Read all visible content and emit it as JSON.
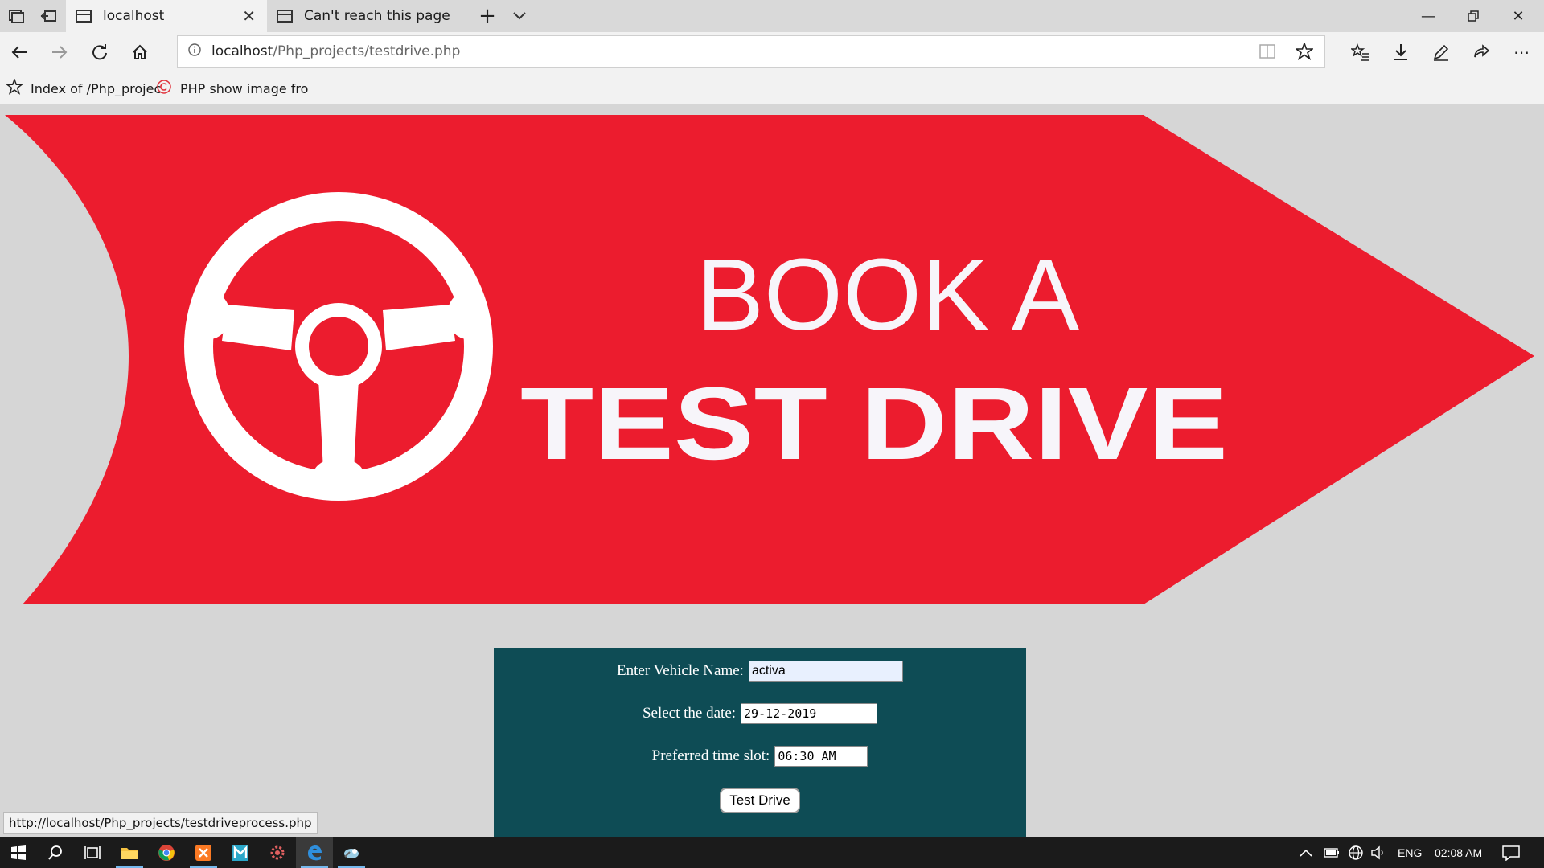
{
  "browser": {
    "tabs": [
      {
        "title": "localhost",
        "active": true
      },
      {
        "title": "Can't reach this page",
        "active": false
      }
    ],
    "address": {
      "host": "localhost",
      "path": "/Php_projects/testdrive.php"
    },
    "favorites": [
      {
        "label": "Index of /Php_projec"
      },
      {
        "label": "PHP show image fro"
      }
    ],
    "status_url": "http://localhost/Php_projects/testdriveprocess.php"
  },
  "banner": {
    "line1": "BOOK A",
    "line2": "TEST DRIVE",
    "colors": {
      "red": "#ec1c2e",
      "text": "#f7f5fa"
    }
  },
  "form": {
    "vehicle_label": "Enter Vehicle Name:",
    "vehicle_value": "activa",
    "date_label": "Select the date:",
    "date_value": "29-12-2019",
    "time_label": "Preferred time slot:",
    "time_value": "06:30 AM",
    "submit_label": "Test Drive",
    "bg_color": "#0e4c55"
  },
  "taskbar": {
    "language": "ENG",
    "time": "02:08 AM",
    "icons": [
      "start-icon",
      "search-icon",
      "task-view-icon",
      "file-explorer-icon",
      "chrome-icon",
      "xampp-icon",
      "app-m-icon",
      "settings-gear-icon",
      "edge-icon",
      "app-bird-icon"
    ]
  }
}
